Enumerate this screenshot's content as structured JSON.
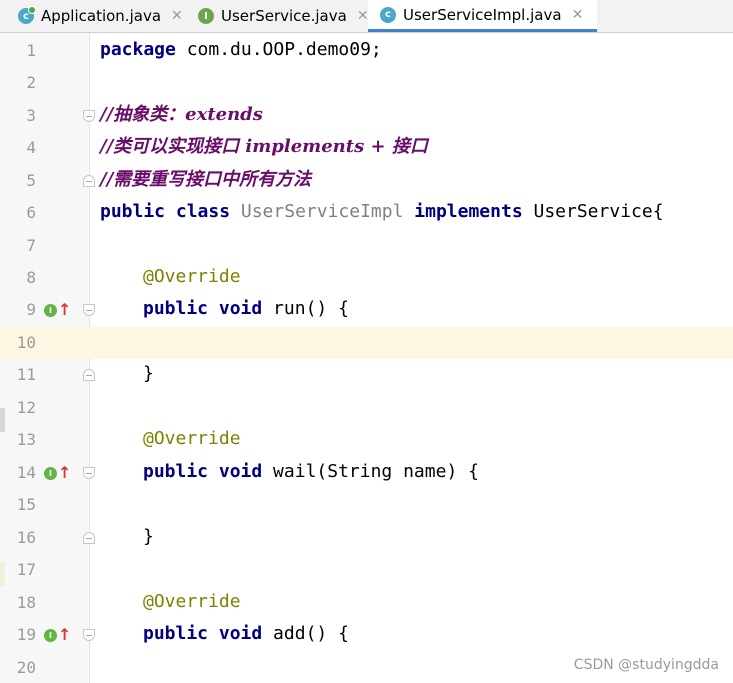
{
  "tabs": [
    {
      "label": "Application.java",
      "icon": "main-class-icon",
      "active": false,
      "close": "✕"
    },
    {
      "label": "UserService.java",
      "icon": "interface-icon",
      "active": false,
      "close": "✕"
    },
    {
      "label": "UserServiceImpl.java",
      "icon": "class-icon",
      "active": true,
      "close": "✕"
    }
  ],
  "tab_icon_letters": {
    "class": "c",
    "interface": "I"
  },
  "accent_color": "#4083c9",
  "implements_marker": {
    "letter": "I",
    "arrow": "↑",
    "color_dot": "#62b543",
    "color_arrow": "#d33b3b"
  },
  "line_numbers": [
    "1",
    "2",
    "3",
    "4",
    "5",
    "6",
    "7",
    "8",
    "9",
    "10",
    "11",
    "12",
    "13",
    "14",
    "15",
    "16",
    "17",
    "18",
    "19",
    "20"
  ],
  "code": {
    "l1_kw": "package",
    "l1_rest": " com.du.OOP.demo09;",
    "l3": "//抽象类：extends",
    "l4": "//类可以实现接口 implements + 接口",
    "l5": "//需要重写接口中所有方法",
    "l6_kw1": "public class",
    "l6_cls": " UserServiceImpl ",
    "l6_kw2": "implements",
    "l6_rest": " UserService{",
    "l8": "@Override",
    "l9_kw": "public void",
    "l9_rest": " run() {",
    "l11": "}",
    "l13": "@Override",
    "l14_kw": "public void",
    "l14_rest": " wail(String name) {",
    "l16": "}",
    "l18": "@Override",
    "l19_kw": "public void",
    "l19_rest": " add() {"
  },
  "watermark": "CSDN @studyingdda"
}
